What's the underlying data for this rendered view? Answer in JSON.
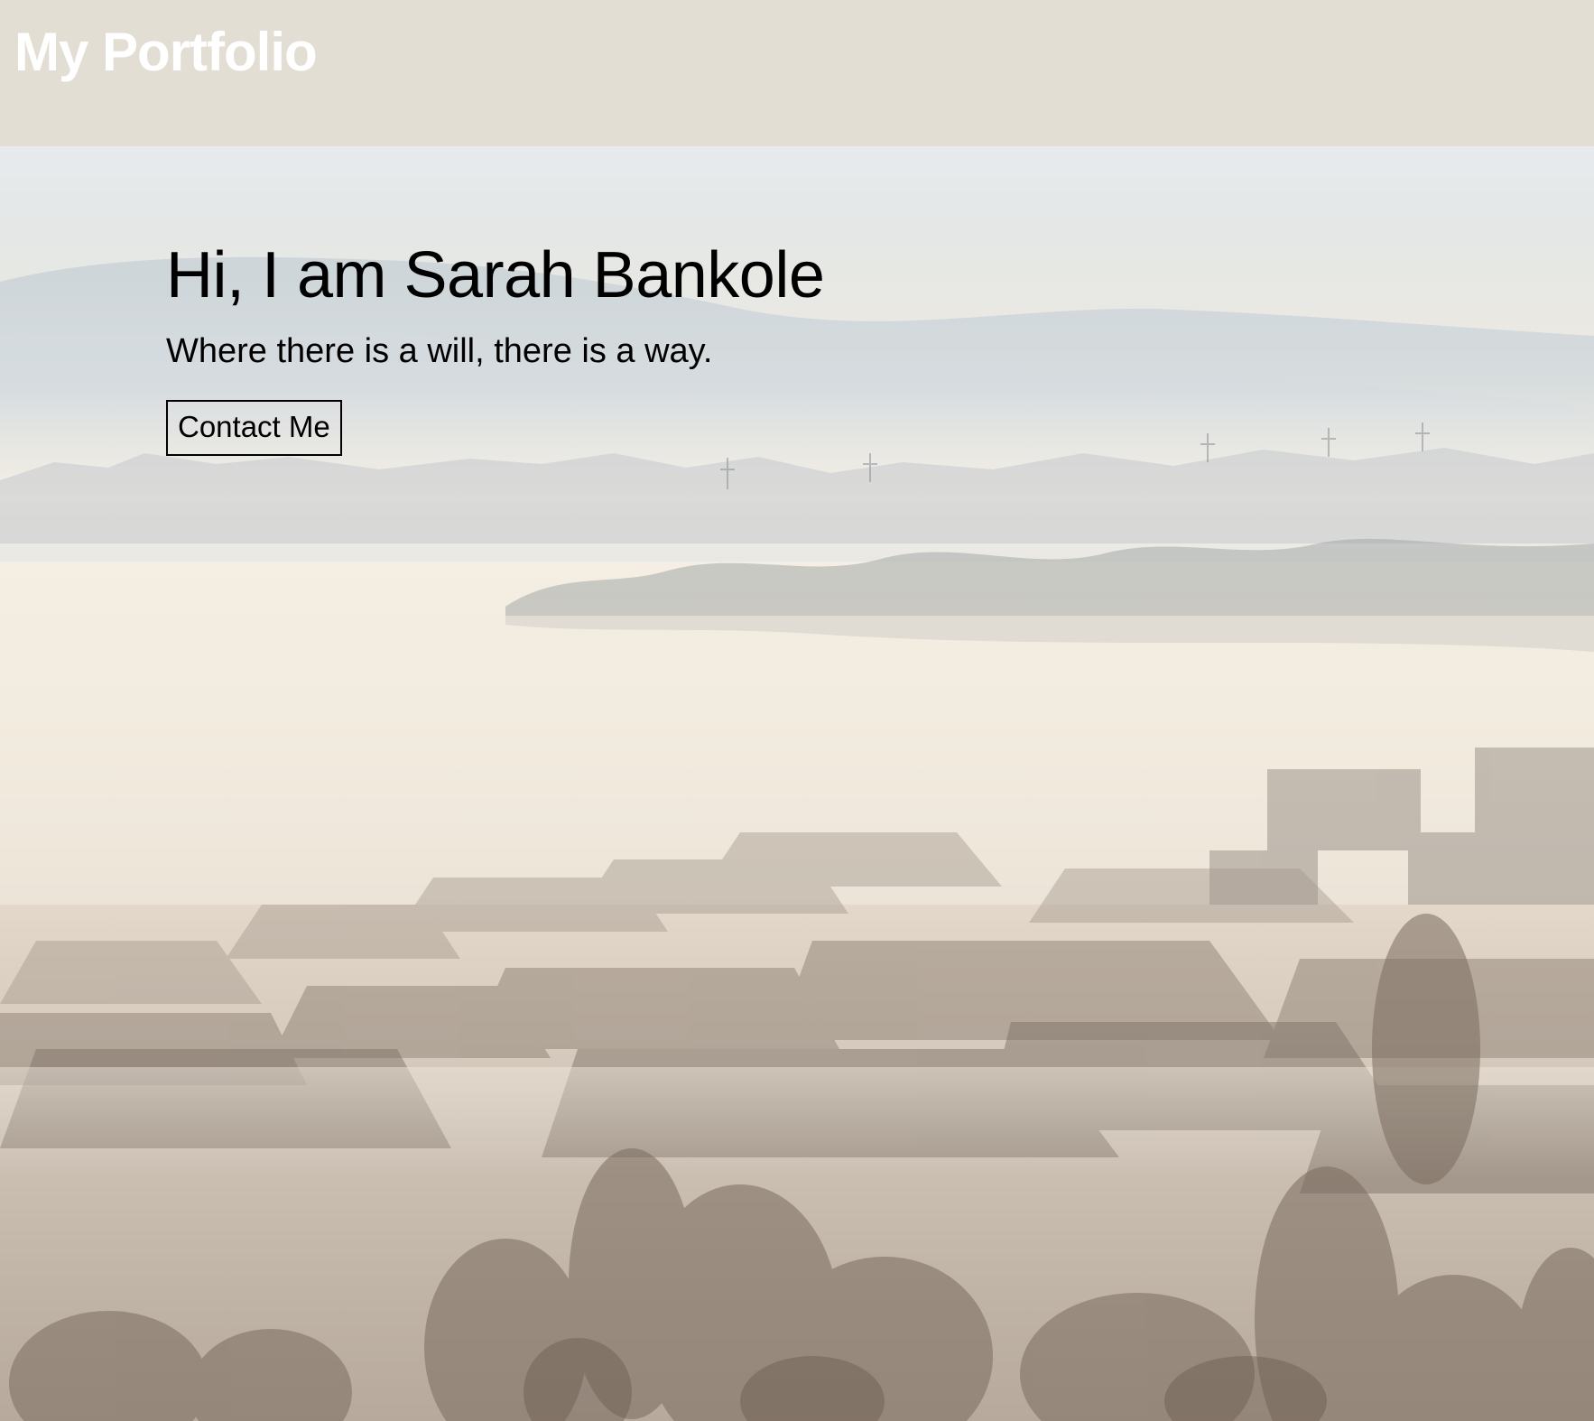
{
  "header": {
    "logo_text": "My Portfolio"
  },
  "hero": {
    "title": "Hi, I am Sarah Bankole",
    "subtitle": "Where there is a will, there is a way.",
    "contact_button_label": "Contact Me"
  },
  "colors": {
    "header_background": "#e3ded4",
    "logo_text": "#ffffff",
    "hero_text": "#000000",
    "button_border": "#000000"
  },
  "icons": {
    "background_image": "foggy-town-landscape-photo"
  }
}
